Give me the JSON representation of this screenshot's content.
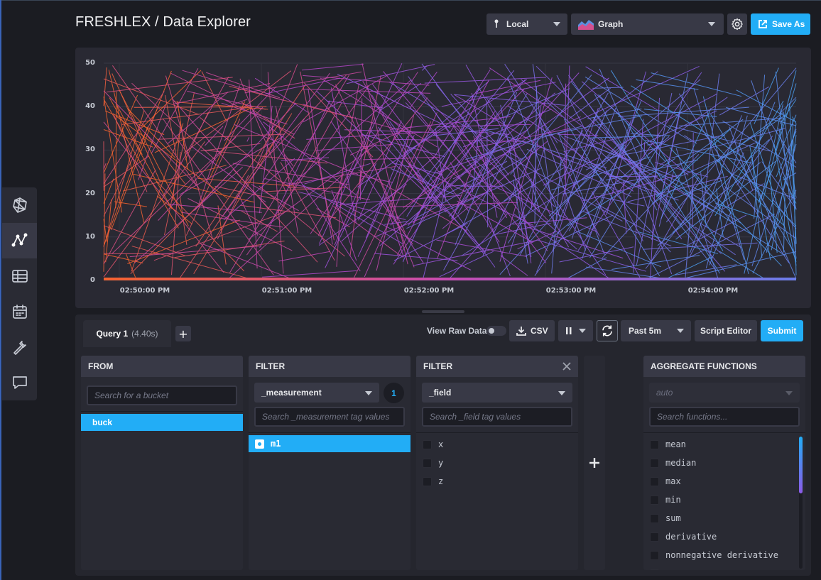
{
  "header": {
    "title": "FRESHLEX / Data Explorer",
    "source_label": "Local",
    "view_label": "Graph",
    "save_label": "Save As"
  },
  "nav": {
    "items": [
      {
        "name": "data-icon",
        "active": false
      },
      {
        "name": "data-explorer-icon",
        "active": true
      },
      {
        "name": "dashboards-icon",
        "active": false
      },
      {
        "name": "tasks-icon",
        "active": false
      },
      {
        "name": "settings-icon",
        "active": false
      },
      {
        "name": "feedback-icon",
        "active": false
      }
    ]
  },
  "chart_data": {
    "type": "line",
    "ylim": [
      0,
      50
    ],
    "yticks": [
      "50",
      "40",
      "30",
      "20",
      "10",
      "0"
    ],
    "xticks": [
      "02:50:00 PM",
      "02:51:00 PM",
      "02:52:00 PM",
      "02:53:00 PM",
      "02:54:00 PM"
    ],
    "grid": true,
    "colors": [
      "#f6632f",
      "#d34b8f",
      "#b846c9",
      "#8d5be8",
      "#6b7dea",
      "#4a9ef0"
    ],
    "note_series": "many dense random series spanning 0-50"
  },
  "query": {
    "tab_name": "Query 1",
    "tab_time": "(4.40s)",
    "raw_data_label": "View Raw Data",
    "csv_label": "CSV",
    "range_label": "Past 5m",
    "script_editor_label": "Script Editor",
    "submit_label": "Submit"
  },
  "from": {
    "header": "FROM",
    "search_placeholder": "Search for a bucket",
    "selected": "buck"
  },
  "filter1": {
    "header": "FILTER",
    "key": "_measurement",
    "count": "1",
    "search_placeholder": "Search _measurement tag values",
    "selected": "m1"
  },
  "filter2": {
    "header": "FILTER",
    "key": "_field",
    "search_placeholder": "Search _field tag values",
    "items": [
      "x",
      "y",
      "z"
    ]
  },
  "aggregate": {
    "header": "AGGREGATE FUNCTIONS",
    "window": "auto",
    "search_placeholder": "Search functions...",
    "items": [
      "mean",
      "median",
      "max",
      "min",
      "sum",
      "derivative",
      "nonnegative derivative"
    ]
  }
}
